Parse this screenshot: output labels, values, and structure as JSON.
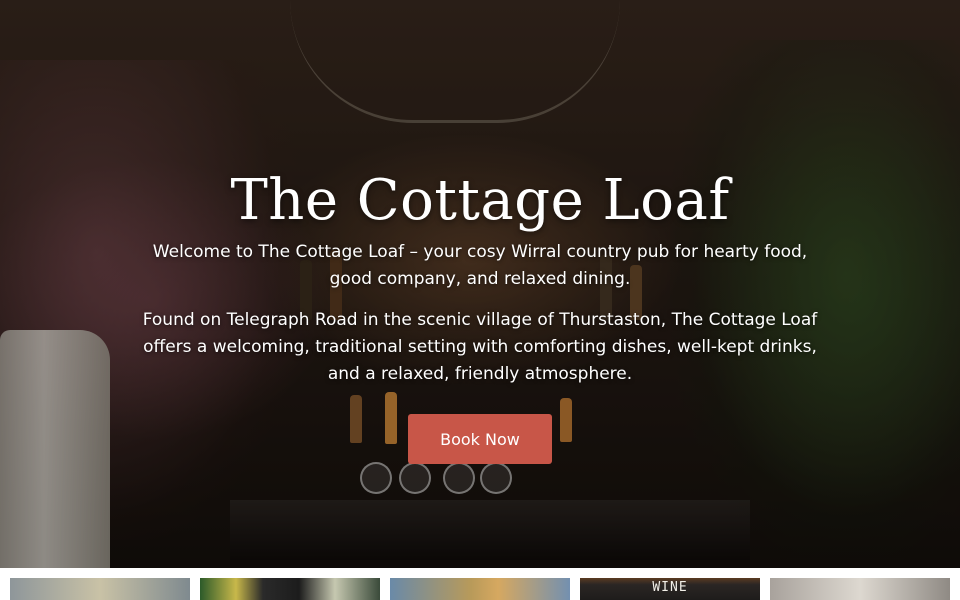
{
  "hero": {
    "title": "The Cottage Loaf",
    "intro": "Welcome to The Cottage Loaf – your cosy Wirral country pub for hearty food, good company, and relaxed dining.",
    "description": "Found on Telegraph Road in the scenic village of Thurstaston, The Cottage Loaf offers a welcoming, traditional setting with comforting dishes, well-kept drinks, and a relaxed, friendly atmosphere.",
    "cta_label": "Book Now",
    "accent_color": "#c85648"
  },
  "gallery": {
    "thumbnails": [
      {
        "name": "food-plate"
      },
      {
        "name": "drinks-fridge"
      },
      {
        "name": "battered-fish"
      },
      {
        "name": "wine-chalkboard",
        "text": "WINE"
      },
      {
        "name": "dining-table"
      }
    ]
  }
}
